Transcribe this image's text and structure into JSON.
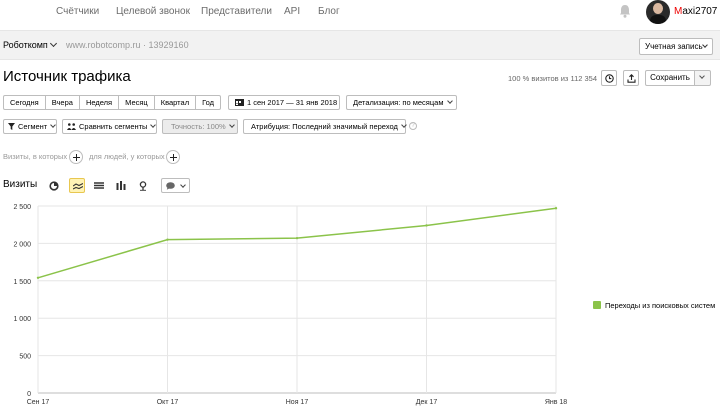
{
  "nav": {
    "items": [
      "Счётчики",
      "Целевой звонок",
      "Представители",
      "API",
      "Блог"
    ],
    "user": {
      "first": "M",
      "rest": "axi2707"
    }
  },
  "counter": {
    "name": "Роботкомп",
    "site": "www.robotcomp.ru · 13929160",
    "account_label": "Учетная запись"
  },
  "report": {
    "title": "Источник трафика",
    "visits_pct": "100 % визитов из 112 354",
    "save_label": "Сохранить"
  },
  "filters": {
    "periods": [
      "Сегодня",
      "Вчера",
      "Неделя",
      "Месяц",
      "Квартал",
      "Год"
    ],
    "date_range": "1 сен 2017 — 31 янв 2018",
    "detail": "Детализация: по месяцам",
    "segment": "Сегмент",
    "compare": "Сравнить сегменты",
    "accuracy": "Точность: 100%",
    "attribution": "Атрибуция: Последний значимый переход",
    "help": "?"
  },
  "segments": {
    "visits_who": "Визиты, в которых",
    "people_who": "для людей, у которых"
  },
  "chart_section": {
    "title": "Визиты",
    "chart_types": [
      "pie-icon",
      "line-chart-icon",
      "area-stack-icon",
      "bar-chart-icon",
      "pin-icon"
    ],
    "active_type": 1
  },
  "chart_data": {
    "type": "line",
    "categories": [
      "Сен 17",
      "Окт 17",
      "Ноя 17",
      "Дек 17",
      "Янв 18"
    ],
    "series": [
      {
        "name": "Переходы из поисковых систем",
        "values": [
          1540,
          2050,
          2070,
          2240,
          2470
        ],
        "color": "#8bc34a"
      }
    ],
    "ylim": [
      0,
      2500
    ],
    "yticks": [
      0,
      500,
      1000,
      1500,
      2000,
      2500
    ],
    "ytick_labels": [
      "0",
      "500",
      "1 000",
      "1 500",
      "2 000",
      "2 500"
    ],
    "grid": true,
    "legend": "right"
  }
}
